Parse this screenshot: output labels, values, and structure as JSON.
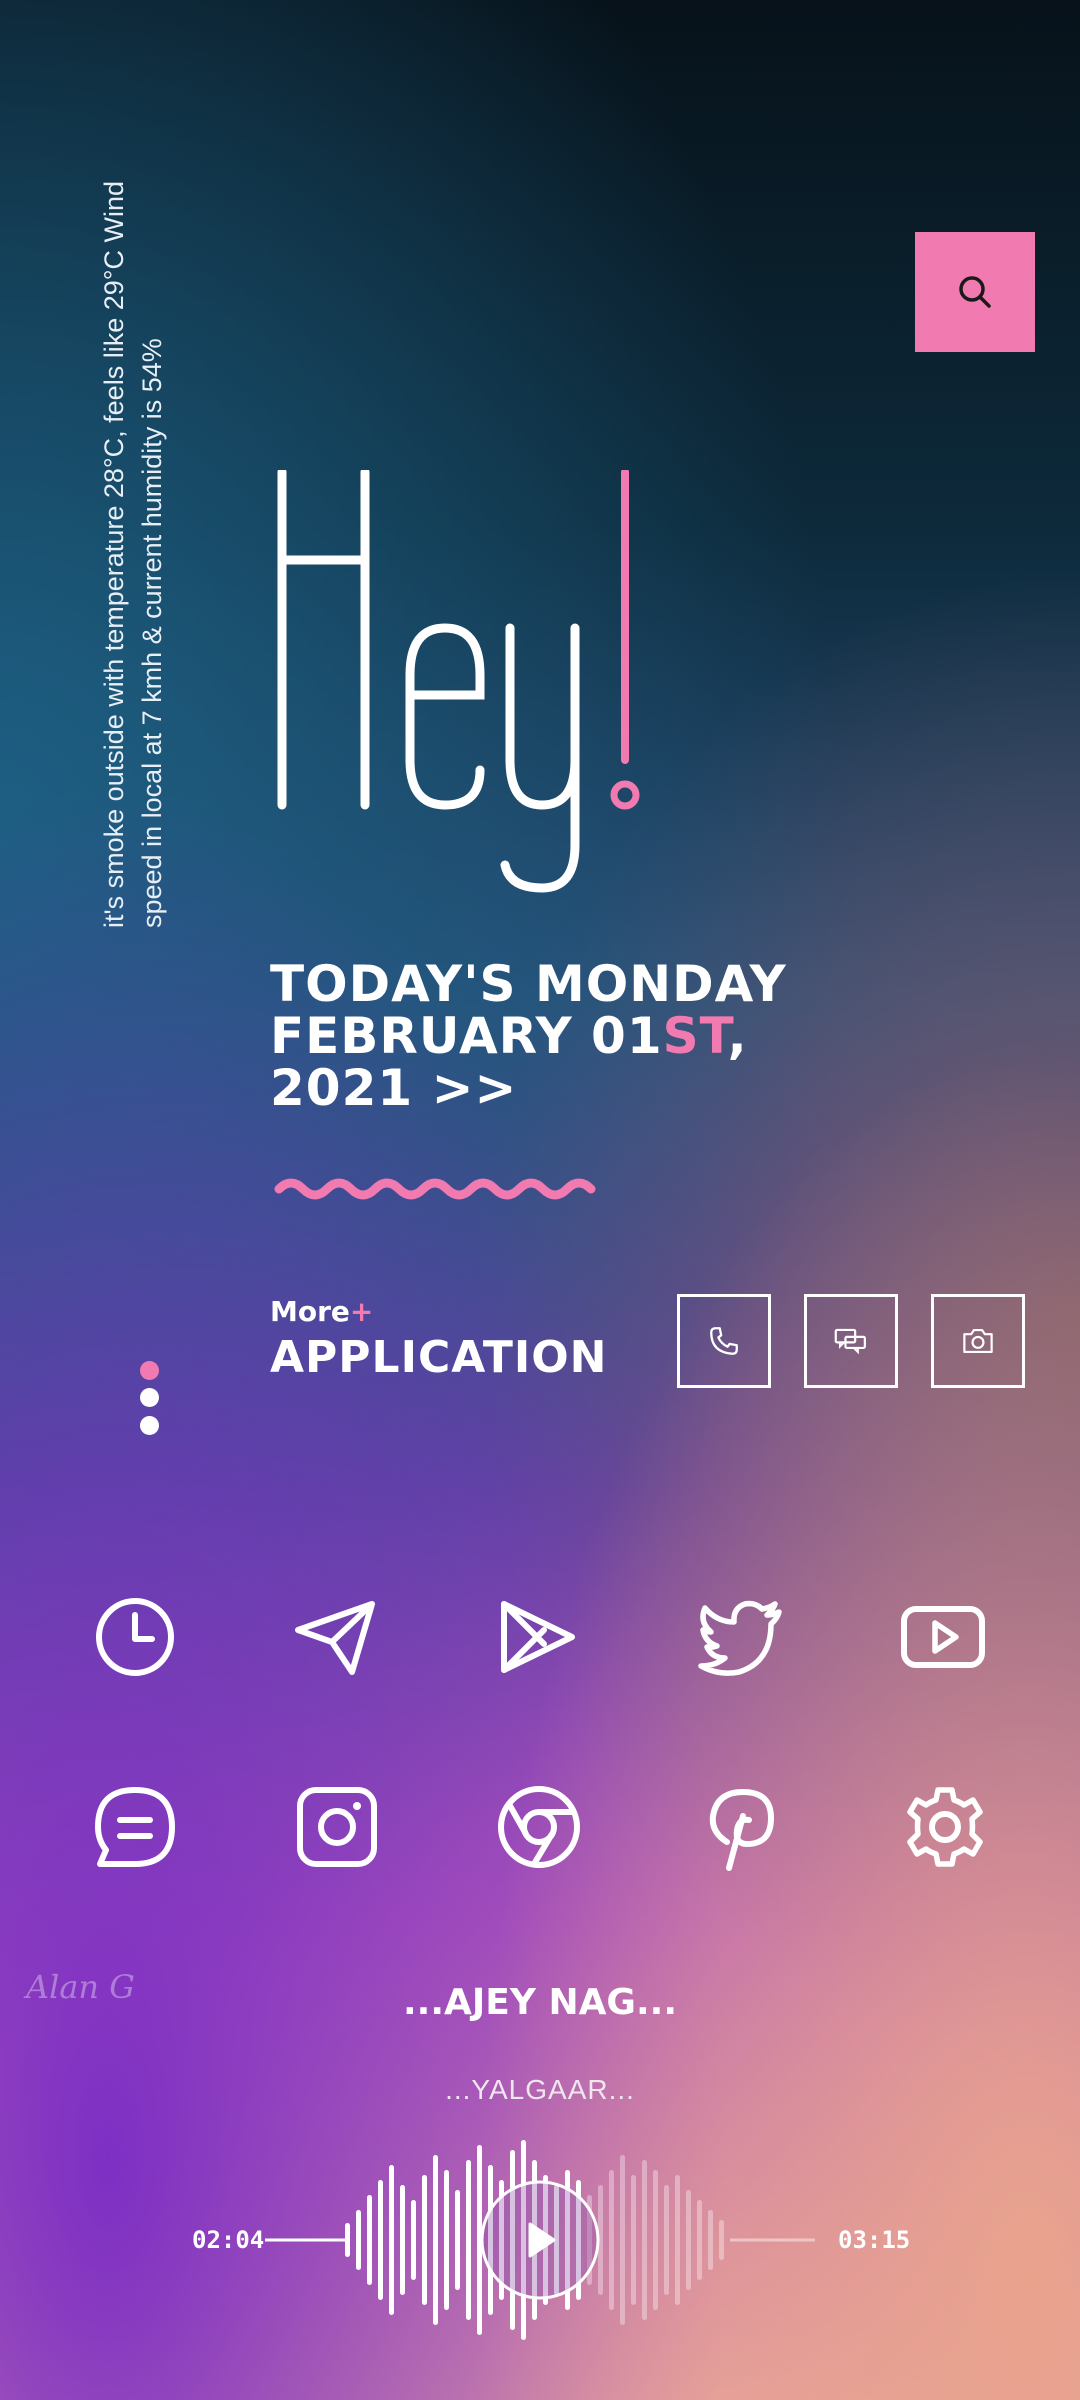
{
  "search": {
    "icon": "search-icon"
  },
  "weather": {
    "text": "it's smoke outside with temperature 28°C, feels like 29°C Wind speed in local at 7 kmh & current humidity is 54%"
  },
  "greeting": {
    "text": "Hey!"
  },
  "date": {
    "line1": "TODAY'S MONDAY",
    "line2_a": "FEBRUARY 01",
    "line2_b": "ST",
    "line2_c": ",",
    "line3": "2021 >>"
  },
  "apps": {
    "more_label": "More",
    "more_plus": "+",
    "application_label": "APPLICATION",
    "shortcuts": [
      "phone-icon",
      "messages-icon",
      "camera-icon"
    ]
  },
  "grid_icons": [
    "clock-icon",
    "telegram-icon",
    "play-store-icon",
    "twitter-icon",
    "youtube-icon",
    "chat-icon",
    "instagram-icon",
    "chrome-icon",
    "pinterest-icon",
    "settings-icon"
  ],
  "signature": "Alan G",
  "player": {
    "artist": "...AJEY NAG...",
    "song": "...YALGAAR...",
    "elapsed": "02:04",
    "duration": "03:15",
    "progress": 0.64
  },
  "colors": {
    "accent": "#f17bb0",
    "text": "#ffffff"
  }
}
